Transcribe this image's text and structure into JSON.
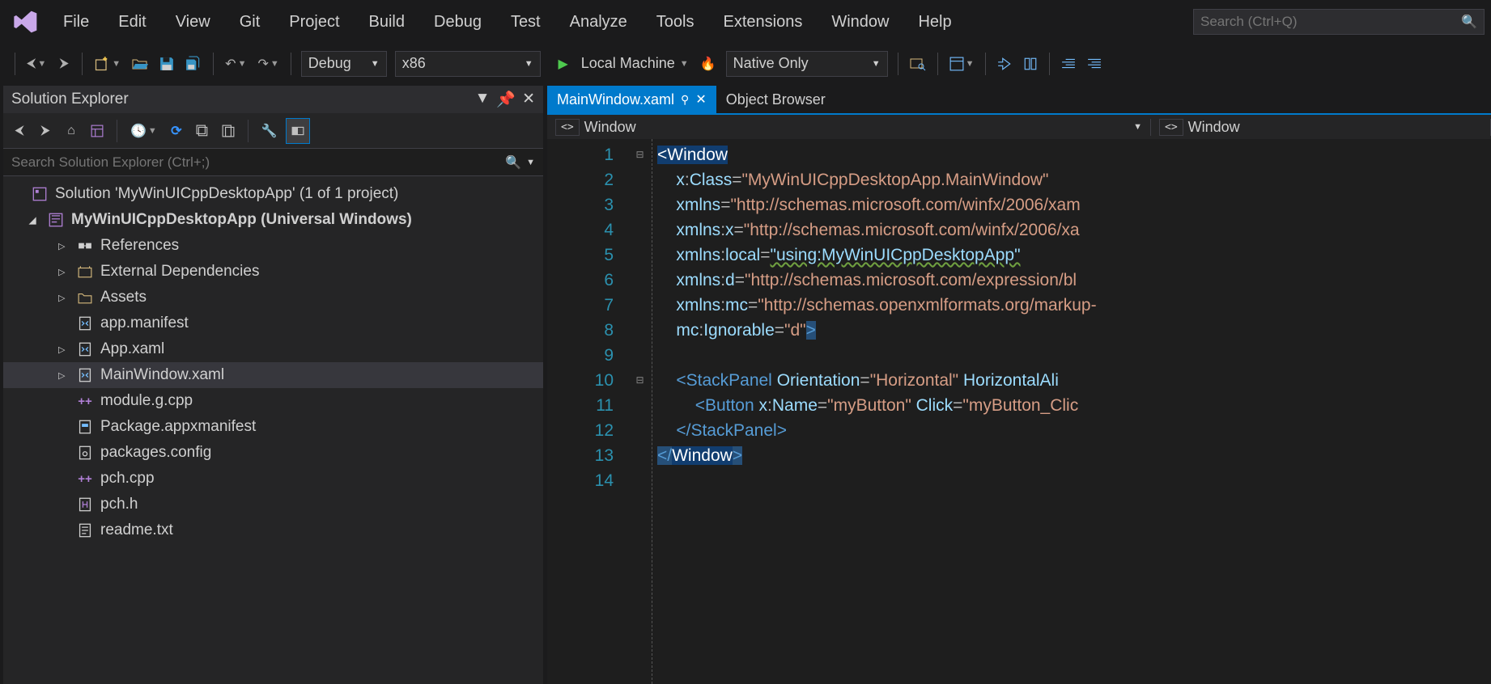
{
  "menubar": [
    "File",
    "Edit",
    "View",
    "Git",
    "Project",
    "Build",
    "Debug",
    "Test",
    "Analyze",
    "Tools",
    "Extensions",
    "Window",
    "Help"
  ],
  "search_placeholder": "Search (Ctrl+Q)",
  "toolbar": {
    "config": "Debug",
    "platform": "x86",
    "run_target": "Local Machine",
    "debugger": "Native Only"
  },
  "solution_explorer": {
    "title": "Solution Explorer",
    "search_placeholder": "Search Solution Explorer (Ctrl+;)",
    "root": "Solution 'MyWinUICppDesktopApp' (1 of 1 project)",
    "project": "MyWinUICppDesktopApp (Universal Windows)",
    "nodes": [
      {
        "label": "References",
        "icon": "ref",
        "exp": "▷",
        "indent": 2
      },
      {
        "label": "External Dependencies",
        "icon": "extdep",
        "exp": "▷",
        "indent": 2
      },
      {
        "label": "Assets",
        "icon": "assets",
        "exp": "▷",
        "indent": 2
      },
      {
        "label": "app.manifest",
        "icon": "xml",
        "exp": "",
        "indent": 2
      },
      {
        "label": "App.xaml",
        "icon": "xaml",
        "exp": "▷",
        "indent": 2
      },
      {
        "label": "MainWindow.xaml",
        "icon": "xaml",
        "exp": "▷",
        "indent": 2,
        "selected": true
      },
      {
        "label": "module.g.cpp",
        "icon": "cpp",
        "exp": "",
        "indent": 2
      },
      {
        "label": "Package.appxmanifest",
        "icon": "pkg",
        "exp": "",
        "indent": 2
      },
      {
        "label": "packages.config",
        "icon": "cfg",
        "exp": "",
        "indent": 2
      },
      {
        "label": "pch.cpp",
        "icon": "cpp",
        "exp": "",
        "indent": 2
      },
      {
        "label": "pch.h",
        "icon": "h",
        "exp": "",
        "indent": 2
      },
      {
        "label": "readme.txt",
        "icon": "txt",
        "exp": "",
        "indent": 2
      }
    ]
  },
  "editor": {
    "tabs": [
      {
        "label": "MainWindow.xaml",
        "active": true,
        "pinned": true
      },
      {
        "label": "Object Browser",
        "active": false
      }
    ],
    "breadcrumbs": [
      {
        "icon": "<>",
        "label": "Window"
      },
      {
        "icon": "<>",
        "label": "Window"
      }
    ],
    "lines": 14,
    "code": [
      {
        "fold": "⊟",
        "indent": 0,
        "tokens": [
          {
            "t": "selw",
            "v": "<"
          },
          {
            "t": "selw",
            "v": "Window"
          }
        ]
      },
      {
        "fold": "",
        "indent": 2,
        "tokens": [
          {
            "t": "attr",
            "v": "x"
          },
          {
            "t": "eq",
            "v": ":"
          },
          {
            "t": "attr",
            "v": "Class"
          },
          {
            "t": "eq",
            "v": "="
          },
          {
            "t": "str",
            "v": "\"MyWinUICppDesktopApp.MainWindow\""
          }
        ]
      },
      {
        "fold": "",
        "indent": 2,
        "tokens": [
          {
            "t": "attr",
            "v": "xmlns"
          },
          {
            "t": "eq",
            "v": "="
          },
          {
            "t": "str",
            "v": "\"http://schemas.microsoft.com/winfx/2006/xam"
          }
        ]
      },
      {
        "fold": "",
        "indent": 2,
        "tokens": [
          {
            "t": "attr",
            "v": "xmlns"
          },
          {
            "t": "eq",
            "v": ":"
          },
          {
            "t": "attr",
            "v": "x"
          },
          {
            "t": "eq",
            "v": "="
          },
          {
            "t": "str",
            "v": "\"http://schemas.microsoft.com/winfx/2006/xa"
          }
        ]
      },
      {
        "fold": "",
        "indent": 2,
        "tokens": [
          {
            "t": "attr",
            "v": "xmlns"
          },
          {
            "t": "eq",
            "v": ":"
          },
          {
            "t": "attr",
            "v": "local"
          },
          {
            "t": "eq",
            "v": "="
          },
          {
            "t": "warn",
            "v": "\"using:MyWinUICppDesktopApp\""
          }
        ]
      },
      {
        "fold": "",
        "indent": 2,
        "tokens": [
          {
            "t": "attr",
            "v": "xmlns"
          },
          {
            "t": "eq",
            "v": ":"
          },
          {
            "t": "attr",
            "v": "d"
          },
          {
            "t": "eq",
            "v": "="
          },
          {
            "t": "str",
            "v": "\"http://schemas.microsoft.com/expression/bl"
          }
        ]
      },
      {
        "fold": "",
        "indent": 2,
        "tokens": [
          {
            "t": "attr",
            "v": "xmlns"
          },
          {
            "t": "eq",
            "v": ":"
          },
          {
            "t": "attr",
            "v": "mc"
          },
          {
            "t": "eq",
            "v": "="
          },
          {
            "t": "str",
            "v": "\"http://schemas.openxmlformats.org/markup-"
          }
        ]
      },
      {
        "fold": "",
        "indent": 2,
        "tokens": [
          {
            "t": "attr",
            "v": "mc"
          },
          {
            "t": "eq",
            "v": ":"
          },
          {
            "t": "attr",
            "v": "Ignorable"
          },
          {
            "t": "eq",
            "v": "="
          },
          {
            "t": "str",
            "v": "\"d\""
          },
          {
            "t": "sel",
            "v": ">"
          }
        ]
      },
      {
        "fold": "",
        "indent": 0,
        "tokens": []
      },
      {
        "fold": "⊟",
        "indent": 2,
        "tokens": [
          {
            "t": "tag",
            "v": "<"
          },
          {
            "t": "tag",
            "v": "StackPanel"
          },
          {
            "t": "el",
            "v": " "
          },
          {
            "t": "attr",
            "v": "Orientation"
          },
          {
            "t": "eq",
            "v": "="
          },
          {
            "t": "str",
            "v": "\"Horizontal\""
          },
          {
            "t": "el",
            "v": " "
          },
          {
            "t": "attr",
            "v": "HorizontalAli"
          }
        ]
      },
      {
        "fold": "",
        "indent": 4,
        "tokens": [
          {
            "t": "tag",
            "v": "<"
          },
          {
            "t": "tag",
            "v": "Button"
          },
          {
            "t": "el",
            "v": " "
          },
          {
            "t": "attr",
            "v": "x"
          },
          {
            "t": "eq",
            "v": ":"
          },
          {
            "t": "attr",
            "v": "Name"
          },
          {
            "t": "eq",
            "v": "="
          },
          {
            "t": "str",
            "v": "\"myButton\""
          },
          {
            "t": "el",
            "v": " "
          },
          {
            "t": "attr",
            "v": "Click"
          },
          {
            "t": "eq",
            "v": "="
          },
          {
            "t": "str",
            "v": "\"myButton_Clic"
          }
        ]
      },
      {
        "fold": "",
        "indent": 2,
        "tokens": [
          {
            "t": "tag",
            "v": "</"
          },
          {
            "t": "tag",
            "v": "StackPanel"
          },
          {
            "t": "tag",
            "v": ">"
          }
        ]
      },
      {
        "fold": "",
        "indent": 0,
        "tokens": [
          {
            "t": "sel",
            "v": "</"
          },
          {
            "t": "selw",
            "v": "Window"
          },
          {
            "t": "sel",
            "v": ">"
          }
        ]
      },
      {
        "fold": "",
        "indent": 0,
        "tokens": []
      }
    ]
  }
}
